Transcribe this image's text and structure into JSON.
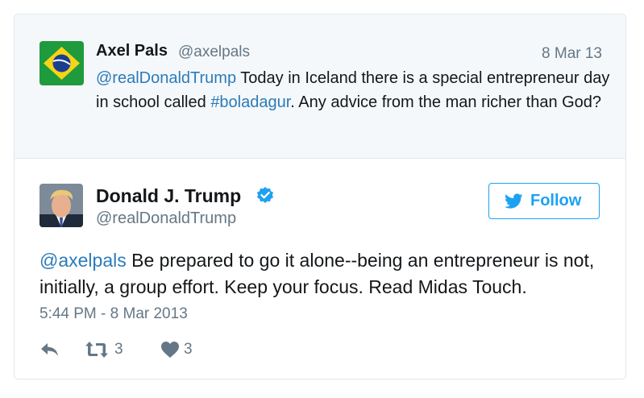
{
  "parent_tweet": {
    "avatar_icon": "brazil-flag-icon",
    "name": "Axel Pals",
    "handle": "@axelpals",
    "date": "8 Mar 13",
    "text_mention": "@realDonaldTrump",
    "text_part1": " Today in Iceland there is a special entrepreneur day in school called ",
    "text_hashtag": "#boladagur",
    "text_part2": ". Any advice from the man richer than God?"
  },
  "tweet": {
    "avatar_icon": "profile-photo",
    "name": "Donald J. Trump",
    "verified_icon": "verified-badge-icon",
    "handle": "@realDonaldTrump",
    "follow_label": "Follow",
    "text_mention": "@axelpals",
    "text_body": " Be prepared to go it alone--being an entrepreneur is not, initially, a group effort. Keep your focus. Read Midas Touch.",
    "timestamp": "5:44 PM - 8 Mar 2013",
    "actions": {
      "reply_icon": "reply-icon",
      "retweet_icon": "retweet-icon",
      "retweet_count": "3",
      "like_icon": "heart-icon",
      "like_count": "3"
    }
  },
  "colors": {
    "link": "#2b7bb9",
    "twitter_blue": "#1da1f2",
    "muted": "#657786",
    "parent_bg": "#f5f8fa"
  }
}
